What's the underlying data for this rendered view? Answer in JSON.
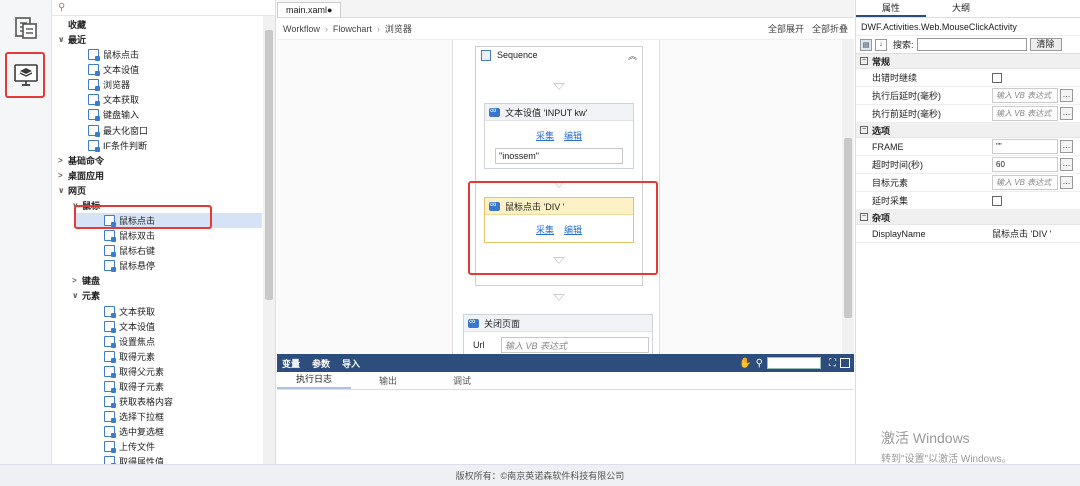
{
  "tree": {
    "rows": [
      {
        "label": "收藏",
        "kind": "cat",
        "arrow": ""
      },
      {
        "label": "最近",
        "kind": "cat",
        "arrow": "∨"
      },
      {
        "label": "鼠标点击",
        "kind": "leaf"
      },
      {
        "label": "文本设值",
        "kind": "leaf"
      },
      {
        "label": "浏览器",
        "kind": "leaf"
      },
      {
        "label": "文本获取",
        "kind": "leaf"
      },
      {
        "label": "键盘输入",
        "kind": "leaf"
      },
      {
        "label": "最大化窗口",
        "kind": "leaf"
      },
      {
        "label": "IF条件判断",
        "kind": "leaf"
      },
      {
        "label": "基础命令",
        "kind": "cat",
        "arrow": ">"
      },
      {
        "label": "桌面应用",
        "kind": "cat",
        "arrow": ">"
      },
      {
        "label": "网页",
        "kind": "cat",
        "arrow": "∨"
      },
      {
        "label": "鼠标",
        "kind": "sub",
        "arrow": "∨"
      },
      {
        "label": "鼠标点击",
        "kind": "leaf2",
        "selected": true
      },
      {
        "label": "鼠标双击",
        "kind": "leaf2"
      },
      {
        "label": "鼠标右键",
        "kind": "leaf2"
      },
      {
        "label": "鼠标悬停",
        "kind": "leaf2"
      },
      {
        "label": "键盘",
        "kind": "sub",
        "arrow": ">"
      },
      {
        "label": "元素",
        "kind": "sub",
        "arrow": "∨"
      },
      {
        "label": "文本获取",
        "kind": "leaf2"
      },
      {
        "label": "文本设值",
        "kind": "leaf2"
      },
      {
        "label": "设置焦点",
        "kind": "leaf2"
      },
      {
        "label": "取得元素",
        "kind": "leaf2"
      },
      {
        "label": "取得父元素",
        "kind": "leaf2"
      },
      {
        "label": "取得子元素",
        "kind": "leaf2"
      },
      {
        "label": "获取表格内容",
        "kind": "leaf2"
      },
      {
        "label": "选择下拉框",
        "kind": "leaf2"
      },
      {
        "label": "选中复选框",
        "kind": "leaf2"
      },
      {
        "label": "上传文件",
        "kind": "leaf2"
      },
      {
        "label": "取得属性值",
        "kind": "leaf2"
      }
    ]
  },
  "designer": {
    "tab": "main.xaml●",
    "breadcrumb": [
      "Workflow",
      "Flowchart",
      "浏览器"
    ],
    "expand_all": "全部展开",
    "collapse_all": "全部折叠",
    "sequence_title": "Sequence",
    "act1_title": "文本设值 'INPUT kw'",
    "act1_capture": "采集",
    "act1_edit": "编辑",
    "act1_value": "\"inossem\"",
    "act2_title": "鼠标点击 'DIV '",
    "act2_capture": "采集",
    "act2_edit": "编辑",
    "act3_title": "关闭页面",
    "act3_url_label": "Url",
    "act3_url_placeholder": "输入 VB 表达式"
  },
  "varbar": {
    "items": [
      "变量",
      "参数",
      "导入"
    ]
  },
  "output": {
    "tabs": [
      "执行日志",
      "输出",
      "调试"
    ]
  },
  "props": {
    "tabs": [
      "属性",
      "大纲"
    ],
    "type_name": "DWF.Activities.Web.MouseClickActivity",
    "search_label": "搜索:",
    "clear_label": "清除",
    "cat_general": "常规",
    "cat_options": "选项",
    "cat_misc": "杂项",
    "p_continue": "出错时继续",
    "p_delay_after": "执行后延时(毫秒)",
    "p_delay_before": "执行前延时(毫秒)",
    "p_frame": "FRAME",
    "p_timeout": "超时时间(秒)",
    "p_target": "目标元素",
    "p_delay_capture": "延时采集",
    "p_display": "DisplayName",
    "v_placeholder": "输入 VB 表达式",
    "v_frame": "\"\"",
    "v_timeout": "60",
    "v_display": "鼠标点击 'DIV '"
  },
  "watermark": {
    "line1": "激活 Windows",
    "line2": "转到\"设置\"以激活 Windows。"
  },
  "footer": "版权所有：©南京英诺森软件科技有限公司"
}
